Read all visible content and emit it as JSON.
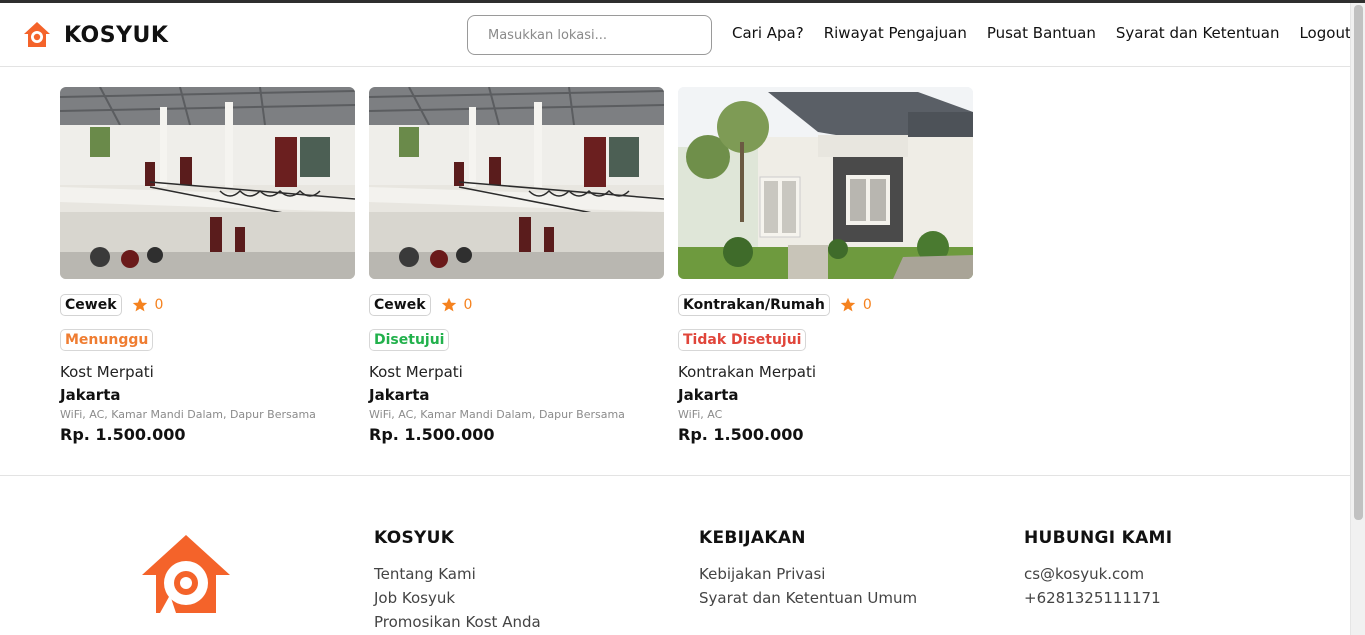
{
  "header": {
    "brand": "KOSYUK",
    "search_placeholder": "Masukkan lokasi...",
    "nav": [
      "Cari Apa?",
      "Riwayat Pengajuan",
      "Pusat Bantuan",
      "Syarat dan Ketentuan",
      "Logout"
    ]
  },
  "colors": {
    "accent": "#f4632a",
    "star": "#f5821f",
    "waiting": "#ef7d32",
    "approved": "#22b14c",
    "rejected": "#e0453a"
  },
  "cards": [
    {
      "type": "Cewek",
      "rating": "0",
      "status": "Menunggu",
      "name": "Kost Merpati",
      "city": "Jakarta",
      "facilities": "WiFi, AC, Kamar Mandi Dalam, Dapur Bersama",
      "price": "Rp. 1.500.000"
    },
    {
      "type": "Cewek",
      "rating": "0",
      "status": "Disetujui",
      "name": "Kost Merpati",
      "city": "Jakarta",
      "facilities": "WiFi, AC, Kamar Mandi Dalam, Dapur Bersama",
      "price": "Rp. 1.500.000"
    },
    {
      "type": "Kontrakan/Rumah",
      "rating": "0",
      "status": "Tidak Disetujui",
      "name": "Kontrakan Merpati",
      "city": "Jakarta",
      "facilities": "WiFi, AC",
      "price": "Rp. 1.500.000"
    }
  ],
  "footer": {
    "kosyuk": {
      "title": "KOSYUK",
      "links": [
        "Tentang Kami",
        "Job Kosyuk",
        "Promosikan Kost Anda"
      ]
    },
    "kebijakan": {
      "title": "KEBIJAKAN",
      "links": [
        "Kebijakan Privasi",
        "Syarat dan Ketentuan Umum"
      ]
    },
    "hubungi": {
      "title": "HUBUNGI KAMI",
      "links": [
        "cs@kosyuk.com",
        "+6281325111171"
      ]
    }
  }
}
